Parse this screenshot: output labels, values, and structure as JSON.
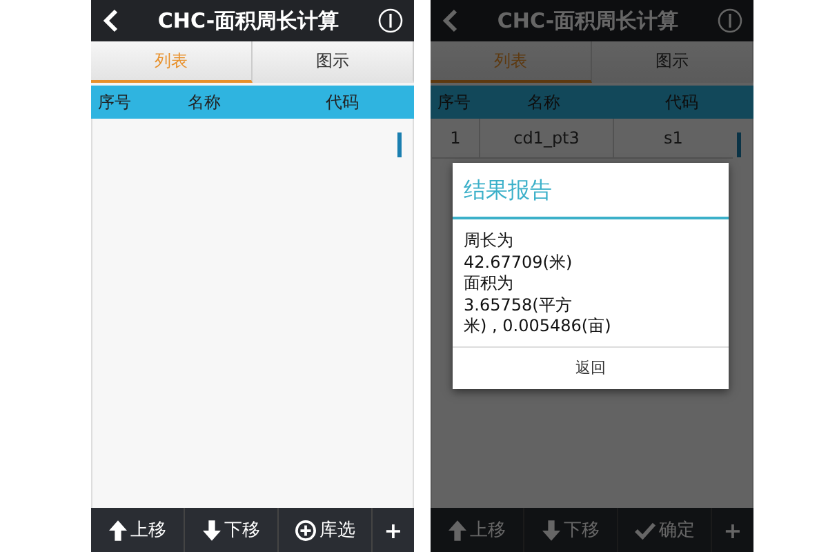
{
  "screens": [
    {
      "title": "CHC-面积周长计算",
      "tabs": [
        {
          "label": "列表",
          "selected": true
        },
        {
          "label": "图示",
          "selected": false
        }
      ],
      "columns": [
        "序号",
        "名称",
        "代码"
      ],
      "toolbar": [
        {
          "kind": "up",
          "label": "上移"
        },
        {
          "kind": "down",
          "label": "下移"
        },
        {
          "kind": "add-circle",
          "label": "库选"
        },
        {
          "kind": "plus",
          "label": "+"
        }
      ]
    },
    {
      "title": "CHC-面积周长计算",
      "tabs": [
        {
          "label": "列表",
          "selected": true
        },
        {
          "label": "图示",
          "selected": false
        }
      ],
      "columns": [
        "序号",
        "名称",
        "代码"
      ],
      "rows": [
        [
          "1",
          "cd1_pt3",
          "s1"
        ]
      ],
      "toolbar": [
        {
          "kind": "up",
          "label": "上移"
        },
        {
          "kind": "down",
          "label": "下移"
        },
        {
          "kind": "check",
          "label": "确定"
        },
        {
          "kind": "plus",
          "label": "+"
        }
      ],
      "dialog": {
        "title": "结果报告",
        "message_lines": [
          "周长为",
          "42.67709(米)",
          "面积为",
          "3.65758(平方",
          "米) , 0.005486(亩)"
        ],
        "button": "返回"
      }
    }
  ]
}
